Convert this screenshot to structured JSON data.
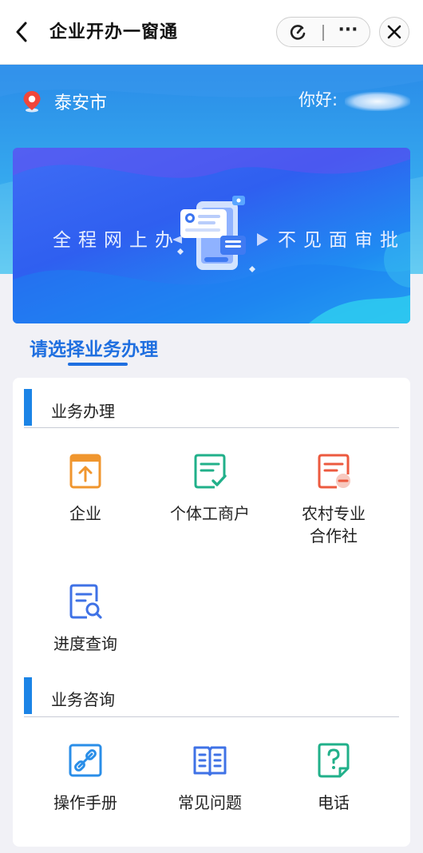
{
  "navbar": {
    "title": "企业开办一窗通",
    "more_label": "···"
  },
  "header": {
    "city": "泰安市",
    "greeting": "你好:"
  },
  "banner": {
    "left_text": "全程网上办",
    "right_text": "不见面审批"
  },
  "select_section": {
    "title": "请选择业务办理"
  },
  "business_section": {
    "title": "业务办理",
    "items": [
      {
        "label": "企业",
        "icon": "upload-doc-icon",
        "color": "#f0962e"
      },
      {
        "label": "个体工商户",
        "icon": "check-doc-icon",
        "color": "#21b08a"
      },
      {
        "label": "农村专业\n合作社",
        "icon": "minus-doc-icon",
        "color": "#ec5a3f"
      },
      {
        "label": "进度查询",
        "icon": "search-doc-icon",
        "color": "#3f72e6"
      }
    ]
  },
  "consult_section": {
    "title": "业务咨询",
    "items": [
      {
        "label": "操作手册",
        "icon": "link-icon",
        "color": "#2a8ee8"
      },
      {
        "label": "常见问题",
        "icon": "open-book-icon",
        "color": "#3f72e6"
      },
      {
        "label": "电话",
        "icon": "question-doc-icon",
        "color": "#21b08a"
      }
    ]
  },
  "colors": {
    "accent": "#1f6fe0",
    "header_blue": "#2a8be8"
  }
}
